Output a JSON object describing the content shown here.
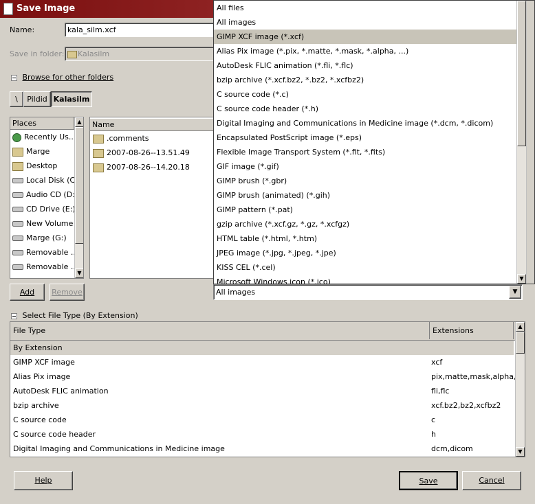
{
  "window": {
    "title": "Save Image"
  },
  "name_field": {
    "label": "Name:",
    "value": "kala_silm.xcf"
  },
  "save_in_folder": {
    "label": "Save in folder:",
    "value": "Kalasilm"
  },
  "browse": {
    "label": "Browse for other folders"
  },
  "path_bar": {
    "root": "\\",
    "items": [
      "Pildid",
      "Kalasilm"
    ]
  },
  "places": {
    "header": "Places",
    "items": [
      {
        "label": "Recently Us...",
        "icon": "recent-icon"
      },
      {
        "label": "Marge",
        "icon": "folder-icon"
      },
      {
        "label": "Desktop",
        "icon": "folder-icon"
      },
      {
        "label": "Local Disk (C:)",
        "icon": "disk-icon"
      },
      {
        "label": "Audio CD (D:)",
        "icon": "disk-icon"
      },
      {
        "label": "CD Drive (E:)",
        "icon": "disk-icon"
      },
      {
        "label": "New Volume ...",
        "icon": "disk-icon"
      },
      {
        "label": "Marge (G:)",
        "icon": "disk-icon"
      },
      {
        "label": "Removable ...",
        "icon": "disk-icon"
      },
      {
        "label": "Removable ...",
        "icon": "disk-icon"
      }
    ],
    "add_label": "Add",
    "remove_label": "Remove"
  },
  "files": {
    "header": "Name",
    "items": [
      ".comments",
      "2007-08-26--13.51.49",
      "2007-08-26--14.20.18"
    ]
  },
  "filter_popup": {
    "items": [
      "All files",
      "All images",
      "GIMP XCF image (*.xcf)",
      "Alias Pix image (*.pix, *.matte, *.mask, *.alpha, ...)",
      "AutoDesk FLIC animation (*.fli, *.flc)",
      "bzip archive (*.xcf.bz2, *.bz2, *.xcfbz2)",
      "C source code (*.c)",
      "C source code header (*.h)",
      "Digital Imaging and Communications in Medicine image (*.dcm, *.dicom)",
      "Encapsulated PostScript image (*.eps)",
      "Flexible Image Transport System (*.fit, *.fits)",
      "GIF image (*.gif)",
      "GIMP brush (*.gbr)",
      "GIMP brush (animated) (*.gih)",
      "GIMP pattern (*.pat)",
      "gzip archive (*.xcf.gz, *.gz, *.xcfgz)",
      "HTML table (*.html, *.htm)",
      "JPEG image (*.jpg, *.jpeg, *.jpe)",
      "KISS CEL (*.cel)",
      "Microsoft Windows icon (*.ico)"
    ],
    "selected_index": 2
  },
  "filter_combo": {
    "value": "All images"
  },
  "file_type": {
    "label": "Select File Type (By Extension)",
    "col_type": "File Type",
    "col_ext": "Extensions",
    "rows": [
      {
        "type": "By Extension",
        "ext": ""
      },
      {
        "type": "GIMP XCF image",
        "ext": "xcf"
      },
      {
        "type": "Alias Pix image",
        "ext": "pix,matte,mask,alpha,als"
      },
      {
        "type": "AutoDesk FLIC animation",
        "ext": "fli,flc"
      },
      {
        "type": "bzip archive",
        "ext": "xcf.bz2,bz2,xcfbz2"
      },
      {
        "type": "C source code",
        "ext": "c"
      },
      {
        "type": "C source code header",
        "ext": "h"
      },
      {
        "type": "Digital Imaging and Communications in Medicine image",
        "ext": "dcm,dicom"
      }
    ]
  },
  "buttons": {
    "help": "Help",
    "save": "Save",
    "cancel": "Cancel"
  }
}
